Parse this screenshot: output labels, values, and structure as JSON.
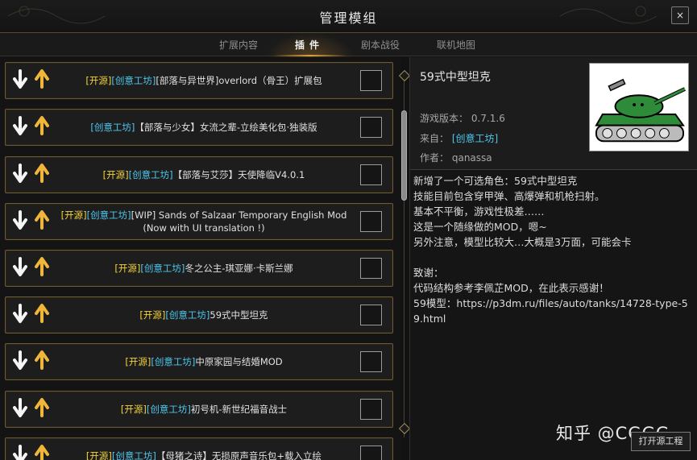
{
  "window": {
    "title": "管理模组",
    "close_label": "×"
  },
  "tabs": [
    {
      "label": "扩展内容",
      "active": false
    },
    {
      "label": "插件",
      "active": true
    },
    {
      "label": "剧本战役",
      "active": false
    },
    {
      "label": "联机地图",
      "active": false
    }
  ],
  "mods": [
    {
      "tags": [
        [
          "开源",
          "kw"
        ],
        [
          "创意工坊",
          "cw"
        ]
      ],
      "name": "[部落与异世界]overlord（骨王）扩展包",
      "checked": false
    },
    {
      "tags": [
        [
          "创意工坊",
          "cw"
        ]
      ],
      "name": "【部落与少女】女流之辈-立绘美化包·独装版",
      "checked": false
    },
    {
      "tags": [
        [
          "开源",
          "kw"
        ],
        [
          "创意工坊",
          "cw"
        ]
      ],
      "name": "【部落与艾莎】天使降临V4.0.1",
      "checked": false
    },
    {
      "tags": [
        [
          "开源",
          "kw"
        ],
        [
          "创意工坊",
          "cw"
        ]
      ],
      "name": "[WIP] Sands of Salzaar Temporary English Mod (Now with UI translation !)",
      "checked": false
    },
    {
      "tags": [
        [
          "开源",
          "kw"
        ],
        [
          "创意工坊",
          "cw"
        ]
      ],
      "name": "冬之公主-琪亚娜·卡斯兰娜",
      "checked": false
    },
    {
      "tags": [
        [
          "开源",
          "kw"
        ],
        [
          "创意工坊",
          "cw"
        ]
      ],
      "name": "59式中型坦克",
      "checked": false
    },
    {
      "tags": [
        [
          "开源",
          "kw"
        ],
        [
          "创意工坊",
          "cw"
        ]
      ],
      "name": "中原家园与结婚MOD",
      "checked": false
    },
    {
      "tags": [
        [
          "开源",
          "kw"
        ],
        [
          "创意工坊",
          "cw"
        ]
      ],
      "name": "初号机-新世纪福音战士",
      "checked": false
    },
    {
      "tags": [
        [
          "开源",
          "kw"
        ],
        [
          "创意工坊",
          "cw"
        ]
      ],
      "name": "【母猪之诗】无损原声音乐包+载入立绘",
      "checked": false
    }
  ],
  "detail": {
    "title": "59式中型坦克",
    "version_label": "游戏版本：",
    "version": "0.7.1.6",
    "source_label": "来自：",
    "source": "[创意工坊]",
    "author_label": "作者：",
    "author": "qanassa",
    "description": [
      "新增了一个可选角色：59式中型坦克",
      "技能目前包含穿甲弹、高爆弹和机枪扫射。",
      "基本不平衡，游戏性极差……",
      "这是一个随缘做的MOD，嗯~",
      "另外注意，模型比较大…大概是3万面，可能会卡",
      "",
      "致谢：",
      "代码结构参考李佩芷MOD，在此表示感谢！",
      "59模型：https://p3dm.ru/files/auto/tanks/14728-type-59.html"
    ]
  },
  "footer": {
    "watermark": "知乎 @CGGG",
    "open_source_button": "打开源工程"
  },
  "colors": {
    "accent_gold": "#d7a046",
    "tag_yellow": "#f2d23a",
    "tag_cyan": "#4ec8ee",
    "row_border": "#6d5a34"
  }
}
